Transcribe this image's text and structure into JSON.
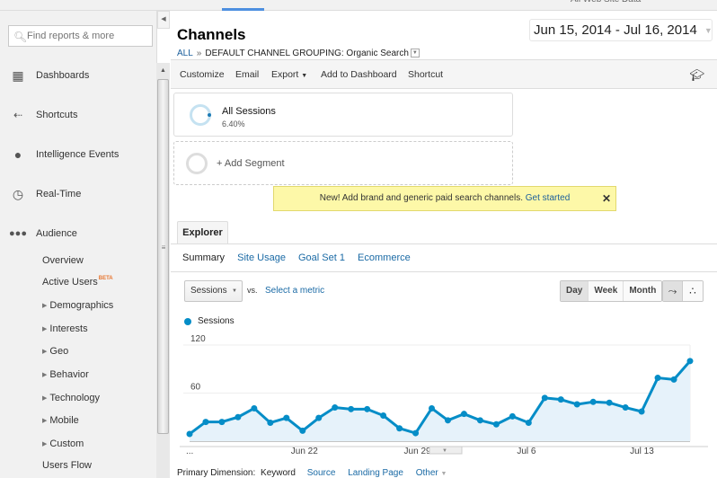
{
  "topbar": {
    "profile": "All Web Site Data"
  },
  "sidebar": {
    "search_placeholder": "Find reports & more",
    "nav": [
      {
        "label": "Dashboards",
        "icon": "grid-icon"
      },
      {
        "label": "Shortcuts",
        "icon": "shortcut-arrow-icon"
      },
      {
        "label": "Intelligence Events",
        "icon": "lightbulb-icon"
      },
      {
        "label": "Real-Time",
        "icon": "clock-icon"
      },
      {
        "label": "Audience",
        "icon": "people-icon"
      }
    ],
    "audience_items": [
      {
        "label": "Overview",
        "expandable": false
      },
      {
        "label": "Active Users",
        "badge": "BETA",
        "expandable": false
      },
      {
        "label": "Demographics",
        "expandable": true
      },
      {
        "label": "Interests",
        "expandable": true
      },
      {
        "label": "Geo",
        "expandable": true
      },
      {
        "label": "Behavior",
        "expandable": true
      },
      {
        "label": "Technology",
        "expandable": true
      },
      {
        "label": "Mobile",
        "expandable": true
      },
      {
        "label": "Custom",
        "expandable": true
      },
      {
        "label": "Users Flow",
        "expandable": false
      }
    ]
  },
  "header": {
    "title": "Channels",
    "breadcrumb_all": "ALL",
    "breadcrumb_sep": "»",
    "breadcrumb_current": "DEFAULT CHANNEL GROUPING: Organic Search",
    "date_range": "Jun 15, 2014 - Jul 16, 2014"
  },
  "toolbar": {
    "customize": "Customize",
    "email": "Email",
    "export": "Export",
    "add_dashboard": "Add to Dashboard",
    "shortcut": "Shortcut"
  },
  "segments": {
    "active": {
      "label": "All Sessions",
      "percent": "6.40%"
    },
    "add": "+ Add Segment"
  },
  "notice": {
    "text": "New! Add brand and generic paid search channels.",
    "link": "Get started",
    "close": "✕"
  },
  "explorer": {
    "tab": "Explorer",
    "subtabs": [
      "Summary",
      "Site Usage",
      "Goal Set 1",
      "Ecommerce"
    ],
    "metric": "Sessions",
    "vs": "vs.",
    "select_metric": "Select a metric",
    "periods": [
      "Day",
      "Week",
      "Month"
    ]
  },
  "colors": {
    "accent": "#058dc7",
    "fill": "#e6f2fa",
    "link": "#1a6aa5"
  },
  "chart_data": {
    "type": "area",
    "title": "",
    "legend": [
      "Sessions"
    ],
    "legend_position": "top-left",
    "x_start": "Jun 15, 2014",
    "x_end": "Jul 16, 2014",
    "x_tick_labels": [
      "...",
      "Jun 22",
      "Jun 29",
      "Jul 6",
      "Jul 13"
    ],
    "y_tick_labels": [
      "60",
      "120"
    ],
    "ylim": [
      0,
      120
    ],
    "grid": true,
    "series": [
      {
        "name": "Sessions",
        "values": [
          9,
          24,
          24,
          30,
          41,
          23,
          29,
          13,
          29,
          42,
          40,
          40,
          32,
          16,
          10,
          41,
          26,
          34,
          26,
          21,
          31,
          23,
          54,
          52,
          46,
          49,
          48,
          42,
          37,
          79,
          77,
          100
        ]
      }
    ]
  },
  "primary_dimension": {
    "label": "Primary Dimension:",
    "active": "Keyword",
    "options": [
      "Source",
      "Landing Page",
      "Other"
    ]
  }
}
